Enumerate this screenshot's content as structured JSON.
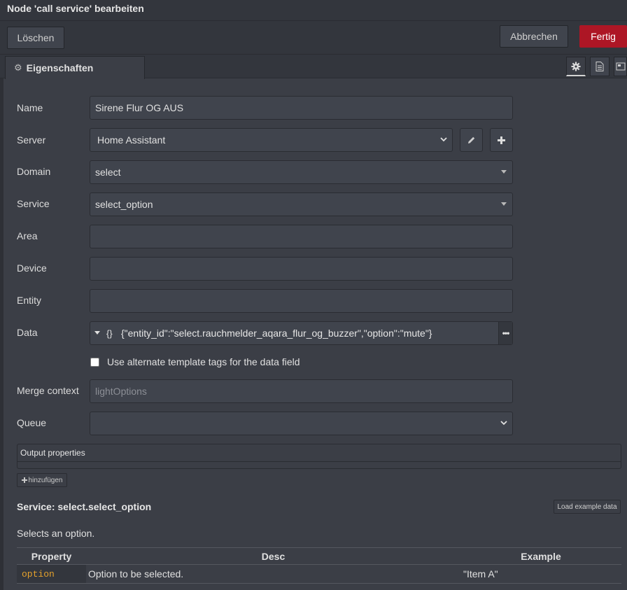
{
  "window": {
    "title": "Node 'call service' bearbeiten"
  },
  "toolbar": {
    "delete_label": "Löschen",
    "cancel_label": "Abbrechen",
    "done_label": "Fertig",
    "done_color": "#ad1625"
  },
  "tabs": {
    "properties_label": "Eigenschaften",
    "icons": [
      "gear-icon",
      "document-icon",
      "layout-icon"
    ]
  },
  "form": {
    "name": {
      "label": "Name",
      "value": "Sirene Flur OG AUS"
    },
    "server": {
      "label": "Server",
      "value": "Home Assistant"
    },
    "domain": {
      "label": "Domain",
      "value": "select"
    },
    "service": {
      "label": "Service",
      "value": "select_option"
    },
    "area": {
      "label": "Area",
      "value": ""
    },
    "device": {
      "label": "Device",
      "value": ""
    },
    "entity": {
      "label": "Entity",
      "value": ""
    },
    "data": {
      "label": "Data",
      "type_symbol": "{}",
      "value": "{\"entity_id\":\"select.rauchmelder_aqara_flur_og_buzzer\",\"option\":\"mute\"}"
    },
    "alt_template": {
      "label": "Use alternate template tags for the data field",
      "checked": false
    },
    "merge_context": {
      "label": "Merge context",
      "placeholder": "lightOptions"
    },
    "queue": {
      "label": "Queue",
      "value": ""
    }
  },
  "output_properties": {
    "title": "Output properties",
    "add_label": "hinzufügen"
  },
  "service_info": {
    "title": "Service: select.select_option",
    "load_example_label": "Load example data",
    "description": "Selects an option.",
    "table": {
      "headers": [
        "Property",
        "Desc",
        "Example"
      ],
      "rows": [
        {
          "property": "option",
          "desc": "Option to be selected.",
          "example": "\"Item A\""
        }
      ]
    }
  }
}
